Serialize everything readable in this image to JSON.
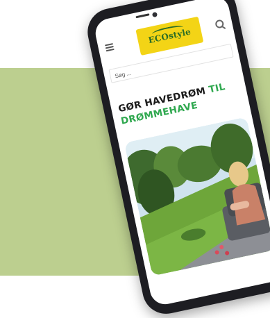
{
  "header": {
    "logo_text": "ECOstyle"
  },
  "search": {
    "placeholder": "Søg ..."
  },
  "hero": {
    "title_main": "GØR HAVEDRØM",
    "title_accent_1": "TIL",
    "title_accent_2": "DRØMMEHAVE"
  },
  "colors": {
    "brand_yellow": "#f3d416",
    "brand_green": "#2b6d25",
    "accent_green": "#2fa84f",
    "background_band": "#bccf8f"
  },
  "icons": {
    "menu": "hamburger-menu-icon",
    "search": "search-icon"
  }
}
